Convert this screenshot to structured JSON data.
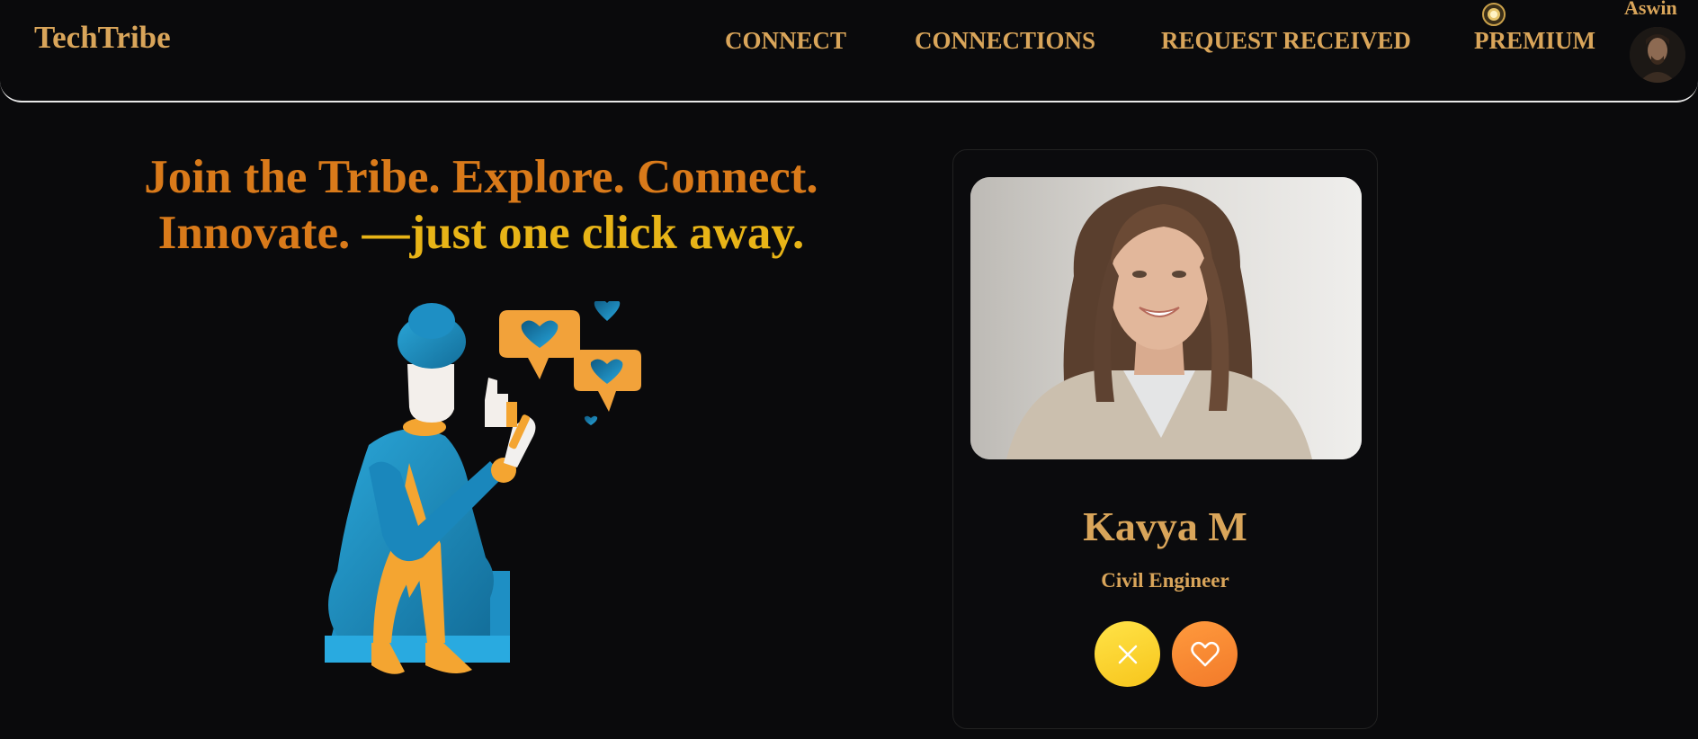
{
  "navbar": {
    "brand": "TechTribe",
    "links": [
      "CONNECT",
      "CONNECTIONS",
      "REQUEST RECEIVED",
      "PREMIUM"
    ],
    "user_name": "Aswin"
  },
  "hero": {
    "line1": "Join the Tribe. Explore. Connect.",
    "line2a": "Innovate. ",
    "line2b": "—just one click away."
  },
  "card": {
    "name": "Kavya M",
    "role": "Civil Engineer",
    "reject_icon": "close-icon",
    "like_icon": "heart-icon"
  },
  "colors": {
    "background": "#0a0a0c",
    "gold": "#d9a55a",
    "orange": "#d97a1a",
    "yellow": "#e8b417"
  }
}
